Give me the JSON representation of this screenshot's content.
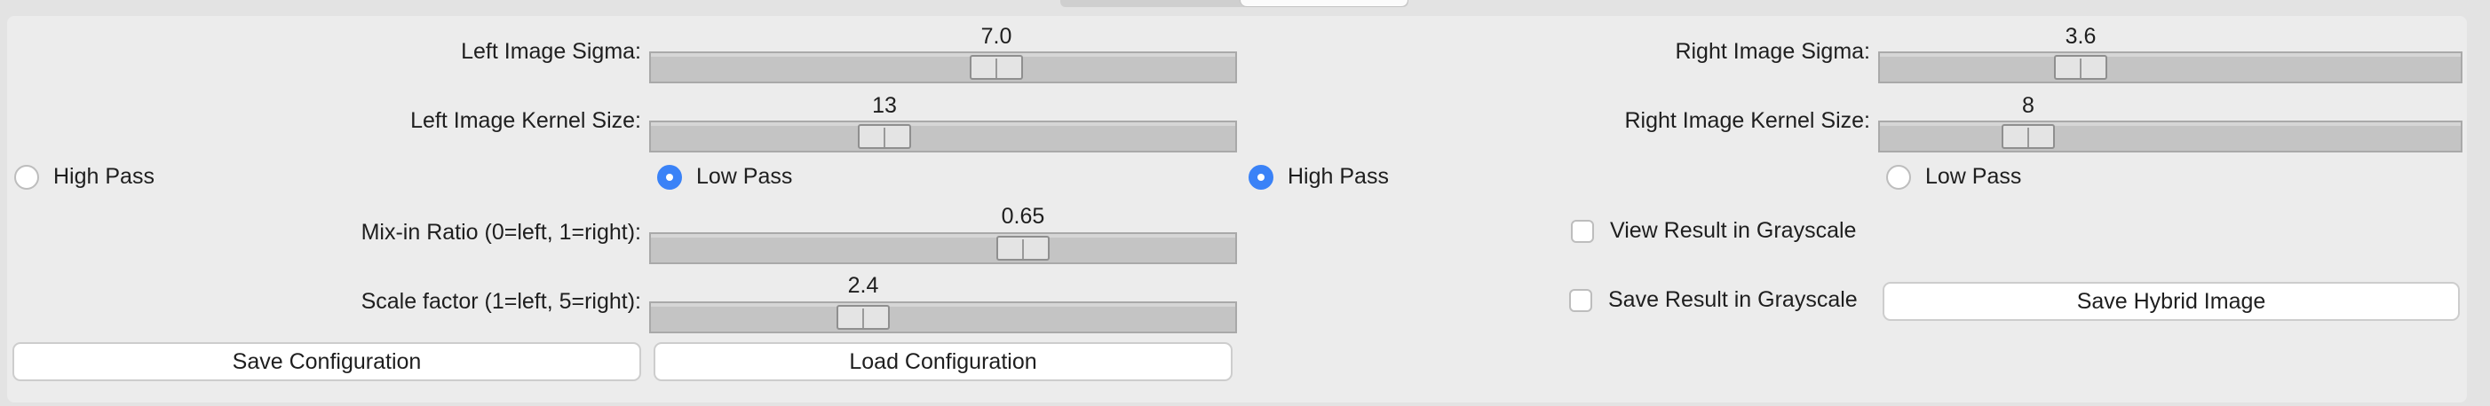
{
  "left_sigma": {
    "label": "Left Image Sigma:",
    "value": "7.0",
    "fraction": 0.6
  },
  "left_kernel": {
    "label": "Left Image Kernel Size:",
    "value": "13",
    "fraction": 0.39
  },
  "right_sigma": {
    "label": "Right Image Sigma:",
    "value": "3.6",
    "fraction": 0.33
  },
  "right_kernel": {
    "label": "Right Image Kernel Size:",
    "value": "8",
    "fraction": 0.23
  },
  "left_filter": {
    "options": [
      "High Pass",
      "Low Pass"
    ],
    "selected": "Low Pass"
  },
  "right_filter": {
    "options": [
      "High Pass",
      "Low Pass"
    ],
    "selected": "High Pass"
  },
  "mix_ratio": {
    "label": "Mix-in Ratio (0=left, 1=right):",
    "value": "0.65",
    "fraction": 0.65
  },
  "scale_factor": {
    "label": "Scale factor (1=left, 5=right):",
    "value": "2.4",
    "fraction": 0.35
  },
  "view_grayscale": {
    "label": "View Result in Grayscale",
    "checked": false
  },
  "save_grayscale": {
    "label": "Save Result in Grayscale",
    "checked": false
  },
  "buttons": {
    "save_hybrid": "Save Hybrid Image",
    "save_config": "Save Configuration",
    "load_config": "Load Configuration"
  },
  "colors": {
    "accent": "#3a82f7",
    "panel": "#ececec",
    "window": "#e3e3e3"
  }
}
